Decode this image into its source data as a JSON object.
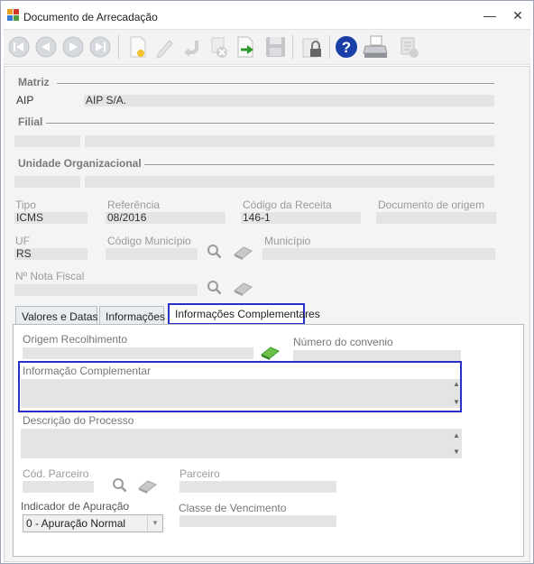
{
  "window": {
    "title": "Documento de Arrecadação",
    "minimize_glyph": "—",
    "close_glyph": "✕"
  },
  "toolbar": {
    "buttons": [
      "first-icon",
      "previous-icon",
      "next-icon",
      "last-icon",
      "new-document-icon",
      "edit-icon",
      "undo-icon",
      "cancel-icon",
      "export-icon",
      "save-icon",
      "lock-icon",
      "help-icon",
      "print-icon",
      "report-icon"
    ]
  },
  "matriz": {
    "section": "Matriz",
    "code": "AIP",
    "name": "AIP S/A."
  },
  "filial": {
    "section": "Filial",
    "code": "",
    "name": ""
  },
  "unidade": {
    "section": "Unidade Organizacional",
    "code": "",
    "name": ""
  },
  "tipo": {
    "label": "Tipo",
    "value": "ICMS"
  },
  "referencia": {
    "label": "Referência",
    "value": "08/2016"
  },
  "codigo_receita": {
    "label": "Código da Receita",
    "value": "146-1"
  },
  "documento_origem": {
    "label": "Documento de origem",
    "value": ""
  },
  "uf": {
    "label": "UF",
    "value": "RS"
  },
  "codigo_municipio": {
    "label": "Código Município",
    "value": ""
  },
  "municipio": {
    "label": "Município",
    "value": ""
  },
  "nota_fiscal": {
    "label": "Nº Nota Fiscal",
    "value": ""
  },
  "tabs": [
    {
      "label": "Valores e Datas",
      "active": false
    },
    {
      "label": "Informações",
      "active": false
    },
    {
      "label": "Informações Complementares",
      "active": true
    }
  ],
  "complementares": {
    "origem_recolhimento": {
      "label": "Origem Recolhimento",
      "value": ""
    },
    "numero_convenio": {
      "label": "Número do convenio",
      "value": ""
    },
    "informacao_complementar": {
      "label": "Informação Complementar",
      "value": ""
    },
    "descricao_processo": {
      "label": "Descrição do Processo",
      "value": ""
    },
    "cod_parceiro": {
      "label": "Cód. Parceiro",
      "value": ""
    },
    "parceiro": {
      "label": "Parceiro",
      "value": ""
    },
    "indicador_apuracao": {
      "label": "Indicador de Apuração",
      "value": "0 - Apuração Normal"
    },
    "classe_vencimento": {
      "label": "Classe de Vencimento",
      "value": ""
    }
  },
  "colors": {
    "highlight": "#2a2fc8",
    "field_bg": "#e4e4e4",
    "label_gray": "#9a9a9a"
  }
}
